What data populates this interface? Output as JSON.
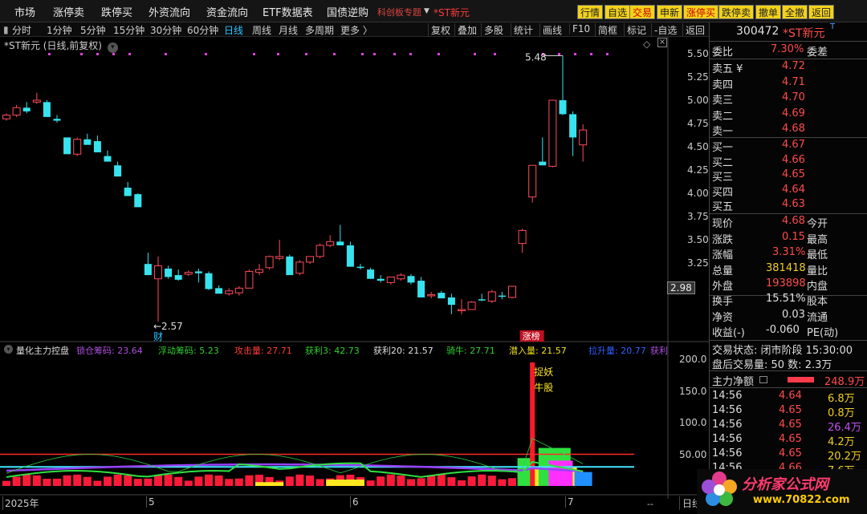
{
  "menu": [
    "市场",
    "涨停卖",
    "跌停买",
    "外资流向",
    "资金流向",
    "ETF数据表",
    "国债逆购"
  ],
  "alert_label": "科创板专题",
  "alert_stock": "*ST新元",
  "right_buttons": [
    {
      "label": "行情",
      "bg": "#f2d21a",
      "fg": "#222"
    },
    {
      "label": "自选",
      "bg": "#f2d21a",
      "fg": "#222"
    },
    {
      "label": "交易",
      "bg": "#f2d21a",
      "fg": "#c00"
    },
    {
      "label": "申新",
      "bg": "#f2d21a",
      "fg": "#222"
    },
    {
      "label": "涨停买",
      "bg": "#f2d21a",
      "fg": "#c00"
    },
    {
      "label": "跌停卖",
      "bg": "#f2d21a",
      "fg": "#222"
    },
    {
      "label": "撤单",
      "bg": "#f2d21a",
      "fg": "#222"
    },
    {
      "label": "全撤",
      "bg": "#f2d21a",
      "fg": "#222"
    },
    {
      "label": "返回",
      "bg": "#f2d21a",
      "fg": "#222"
    }
  ],
  "periods": [
    "分时",
    "1分钟",
    "5分钟",
    "15分钟",
    "30分钟",
    "60分钟",
    "日线",
    "周线",
    "月线",
    "多周期",
    "更多 〉"
  ],
  "period_active": "日线",
  "tools": [
    "复权",
    "叠加",
    "多股",
    "统计",
    "画线",
    "F10",
    "简框",
    "标记",
    "-自选",
    "返回"
  ],
  "chart_title": "*ST新元 (日线,前复权)",
  "price_axis": [
    "5.50",
    "5.25",
    "5.00",
    "4.75",
    "4.50",
    "4.25",
    "4.00",
    "3.75",
    "3.50",
    "3.25"
  ],
  "last_price_tag": "2.98",
  "high_mark": "5.48",
  "low_mark": "2.57",
  "cai_label": "财",
  "limit_label": "涨榜",
  "indicator_name": "量化主力控盘",
  "indicator_items": [
    {
      "t": "锁仓筹码: 23.64",
      "c": "#b050e0"
    },
    {
      "t": "浮动筹码: 5.23",
      "c": "#30d030"
    },
    {
      "t": "攻击量: 27.71",
      "c": "#ff3b3b"
    },
    {
      "t": "获利3: 42.73",
      "c": "#30d030"
    },
    {
      "t": "获利20: 21.57",
      "c": "#e0e0e0"
    },
    {
      "t": "骑牛: 27.71",
      "c": "#30d030"
    },
    {
      "t": "潜入量: 21.57",
      "c": "#f0e020"
    },
    {
      "t": "拉升量: 20.77",
      "c": "#3060ff"
    },
    {
      "t": "获利",
      "c": "#b050e0"
    }
  ],
  "ind_axis": [
    "200.0",
    "150.0",
    "100.0",
    "50.00"
  ],
  "capture_label": "捉妖",
  "bull_label": "牛股",
  "date_axis": [
    "2025年",
    "5",
    "6",
    "7"
  ],
  "bottom_right": "日线",
  "stock": {
    "code": "300472",
    "name": "*ST新元",
    "badge": "T"
  },
  "wb": {
    "label": "委比",
    "value": "7.30%",
    "label2": "委差"
  },
  "sells": [
    {
      "label": "卖五 ¥",
      "price": "4.72"
    },
    {
      "label": "卖四",
      "price": "4.71"
    },
    {
      "label": "卖三",
      "price": "4.70"
    },
    {
      "label": "卖二",
      "price": "4.69"
    },
    {
      "label": "卖一",
      "price": "4.68"
    }
  ],
  "buys": [
    {
      "label": "买一",
      "price": "4.67"
    },
    {
      "label": "买二",
      "price": "4.66"
    },
    {
      "label": "买三",
      "price": "4.65"
    },
    {
      "label": "买四",
      "price": "4.64"
    },
    {
      "label": "买五",
      "price": "4.63"
    }
  ],
  "quote": [
    {
      "l": "现价",
      "v": "4.68",
      "c": "#ff4b4b",
      "l2": "今开"
    },
    {
      "l": "涨跌",
      "v": "0.15",
      "c": "#ff4b4b",
      "l2": "最高"
    },
    {
      "l": "涨幅",
      "v": "3.31%",
      "c": "#ff4b4b",
      "l2": "最低"
    },
    {
      "l": "总量",
      "v": "381418",
      "c": "#f0d020",
      "l2": "量比"
    },
    {
      "l": "外盘",
      "v": "193898",
      "c": "#ff4b4b",
      "l2": "内盘"
    }
  ],
  "quote2": [
    {
      "l": "换手",
      "v": "15.51%",
      "c": "#e0e0e0",
      "l2": "股本"
    },
    {
      "l": "净资",
      "v": "0.03",
      "c": "#e0e0e0",
      "l2": "流通"
    },
    {
      "l": "收益(-)",
      "v": "-0.060",
      "c": "#e0e0e0",
      "l2": "PE(动)"
    }
  ],
  "status": "交易状态: 闭市阶段 15:30:00",
  "after_hours": "盘后交易量: 50  数: 2.3万",
  "flow_label": "主力净额",
  "flow_value": "248.9万",
  "ticks": [
    {
      "t": "14:56",
      "p": "4.64",
      "v": "6.8万",
      "vc": "#f0d020"
    },
    {
      "t": "14:56",
      "p": "4.65",
      "v": "0.8万",
      "vc": "#f0d020"
    },
    {
      "t": "14:56",
      "p": "4.65",
      "v": "26.4万",
      "vc": "#c050f0"
    },
    {
      "t": "14:56",
      "p": "4.65",
      "v": "4.2万",
      "vc": "#f0d020"
    },
    {
      "t": "14:56",
      "p": "4.65",
      "v": "20.2万",
      "vc": "#f0d020"
    },
    {
      "t": "14:56",
      "p": "4.66",
      "v": "7.6万",
      "vc": "#f0d020"
    }
  ],
  "logo_text": "分析家公式网",
  "logo_url": "www.70822.com",
  "candles": [
    [
      4.8,
      4.86,
      4.78,
      4.84
    ],
    [
      4.84,
      4.95,
      4.82,
      4.92
    ],
    [
      4.92,
      4.98,
      4.86,
      4.88
    ],
    [
      4.98,
      5.08,
      4.96,
      5.0
    ],
    [
      4.98,
      5.0,
      4.84,
      4.82
    ],
    [
      4.8,
      4.84,
      4.76,
      4.78
    ],
    [
      4.6,
      4.6,
      4.44,
      4.42
    ],
    [
      4.42,
      4.6,
      4.4,
      4.58
    ],
    [
      4.58,
      4.64,
      4.54,
      4.52
    ],
    [
      4.56,
      4.62,
      4.46,
      4.44
    ],
    [
      4.4,
      4.46,
      4.36,
      4.34
    ],
    [
      4.3,
      4.34,
      4.2,
      4.18
    ],
    [
      4.06,
      4.12,
      3.99,
      3.97
    ],
    [
      3.99,
      4.0,
      3.88,
      3.85
    ],
    [
      3.24,
      3.36,
      3.12,
      3.12
    ],
    [
      3.08,
      3.32,
      2.62,
      3.22
    ],
    [
      3.19,
      3.22,
      3.08,
      3.1
    ],
    [
      3.12,
      3.18,
      3.06,
      3.07
    ],
    [
      3.13,
      3.17,
      3.11,
      3.15
    ],
    [
      3.16,
      3.19,
      3.04,
      3.14
    ],
    [
      3.14,
      3.16,
      2.96,
      2.97
    ],
    [
      2.98,
      3.01,
      2.95,
      2.92
    ],
    [
      2.92,
      2.98,
      2.9,
      2.95
    ],
    [
      2.93,
      3.0,
      2.9,
      2.98
    ],
    [
      2.98,
      3.18,
      2.98,
      3.16
    ],
    [
      3.15,
      3.24,
      3.12,
      3.18
    ],
    [
      3.2,
      3.33,
      3.18,
      3.32
    ],
    [
      3.3,
      3.5,
      3.28,
      3.32
    ],
    [
      3.32,
      3.34,
      3.13,
      3.12
    ],
    [
      3.14,
      3.28,
      3.12,
      3.26
    ],
    [
      3.26,
      3.32,
      3.24,
      3.32
    ],
    [
      3.32,
      3.46,
      3.3,
      3.44
    ],
    [
      3.44,
      3.55,
      3.42,
      3.48
    ],
    [
      3.48,
      3.66,
      3.46,
      3.44
    ],
    [
      3.44,
      3.48,
      3.22,
      3.21
    ],
    [
      3.21,
      3.24,
      3.18,
      3.2
    ],
    [
      3.18,
      3.2,
      3.08,
      3.08
    ],
    [
      3.08,
      3.12,
      3.04,
      3.06
    ],
    [
      3.04,
      3.09,
      3.02,
      3.1
    ],
    [
      3.08,
      3.14,
      3.06,
      3.12
    ],
    [
      3.11,
      3.13,
      3.02,
      3.04
    ],
    [
      3.06,
      3.1,
      2.89,
      2.88
    ],
    [
      2.9,
      2.94,
      2.87,
      2.91
    ],
    [
      2.93,
      2.95,
      2.9,
      2.87
    ],
    [
      2.88,
      2.92,
      2.7,
      2.8
    ],
    [
      2.74,
      2.86,
      2.7,
      2.75
    ],
    [
      2.75,
      2.84,
      2.78,
      2.83
    ],
    [
      2.86,
      2.92,
      2.84,
      2.85
    ],
    [
      2.84,
      2.96,
      2.82,
      2.94
    ],
    [
      2.9,
      2.94,
      2.86,
      2.89
    ],
    [
      2.88,
      3.0,
      2.87,
      3.0
    ],
    [
      3.46,
      3.62,
      3.36,
      3.6
    ],
    [
      3.96,
      4.14,
      3.9,
      4.3
    ],
    [
      4.34,
      4.6,
      4.3,
      4.3
    ],
    [
      4.29,
      4.96,
      4.28,
      5.0
    ],
    [
      5.0,
      5.48,
      4.84,
      4.85
    ],
    [
      4.85,
      4.88,
      4.4,
      4.6
    ],
    [
      4.52,
      4.74,
      4.34,
      4.68
    ]
  ],
  "markers": [
    62,
    102,
    122,
    142,
    162,
    207,
    257,
    317,
    347,
    382,
    417,
    452,
    467,
    492,
    512,
    547,
    592,
    617,
    677,
    697,
    717,
    737,
    757
  ]
}
